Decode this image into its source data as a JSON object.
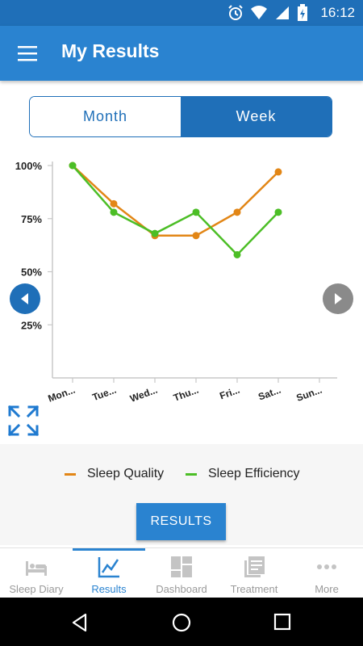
{
  "status": {
    "time": "16:12"
  },
  "header": {
    "title": "My Results"
  },
  "toggle": {
    "month_label": "Month",
    "week_label": "Week",
    "selected": "Week"
  },
  "chart_data": {
    "type": "line",
    "categories": [
      "Mon...",
      "Tue...",
      "Wed...",
      "Thu...",
      "Fri...",
      "Sat...",
      "Sun..."
    ],
    "y_ticks": [
      "100%",
      "75%",
      "50%",
      "25%"
    ],
    "ylim": [
      0,
      100
    ],
    "series": [
      {
        "name": "Sleep Quality",
        "color": "#e28616",
        "values": [
          100,
          82,
          67,
          67,
          78,
          97,
          null
        ]
      },
      {
        "name": "Sleep Efficiency",
        "color": "#4cbe26",
        "values": [
          100,
          78,
          68,
          78,
          58,
          78,
          null
        ]
      }
    ]
  },
  "legend": {
    "quality_label": "Sleep Quality",
    "efficiency_label": "Sleep Efficiency"
  },
  "results_button": "RESULTS",
  "tabs": [
    {
      "label": "Sleep Diary",
      "icon": "bed-icon"
    },
    {
      "label": "Results",
      "icon": "line-chart-icon"
    },
    {
      "label": "Dashboard",
      "icon": "dashboard-icon"
    },
    {
      "label": "Treatment",
      "icon": "document-stack-icon"
    },
    {
      "label": "More",
      "icon": "more-dots-icon"
    }
  ],
  "colors": {
    "primary": "#2a83d0",
    "dark_primary": "#1f6fb8",
    "quality": "#e28616",
    "efficiency": "#4cbe26"
  }
}
